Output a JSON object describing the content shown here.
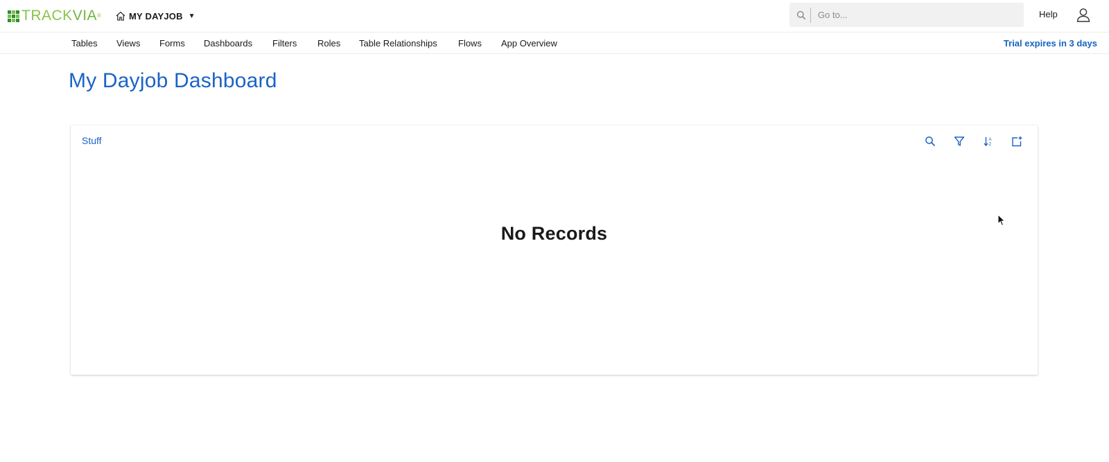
{
  "header": {
    "logo": {
      "part1": "TRACK",
      "part2": "VIA",
      "mark": "®"
    },
    "app_name": "MY DAYJOB",
    "search": {
      "placeholder": "Go to...",
      "value": ""
    },
    "help_label": "Help"
  },
  "nav": {
    "items": [
      {
        "label": "Tables"
      },
      {
        "label": "Views"
      },
      {
        "label": "Forms"
      },
      {
        "label": "Dashboards"
      },
      {
        "label": "Filters"
      },
      {
        "label": "Roles"
      },
      {
        "label": "Table Relationships"
      },
      {
        "label": "Flows"
      },
      {
        "label": "App Overview"
      }
    ],
    "trial_notice": "Trial expires in 3 days"
  },
  "page": {
    "title": "My Dayjob Dashboard"
  },
  "panel": {
    "title": "Stuff",
    "empty_message": "No Records",
    "tools": [
      "search-icon",
      "filter-icon",
      "sort-icon",
      "add-record-icon"
    ]
  },
  "colors": {
    "brand_green": "#79c043",
    "accent_blue": "#1b63c6",
    "link_blue": "#1564c0",
    "search_bg": "#f1f1f1"
  }
}
